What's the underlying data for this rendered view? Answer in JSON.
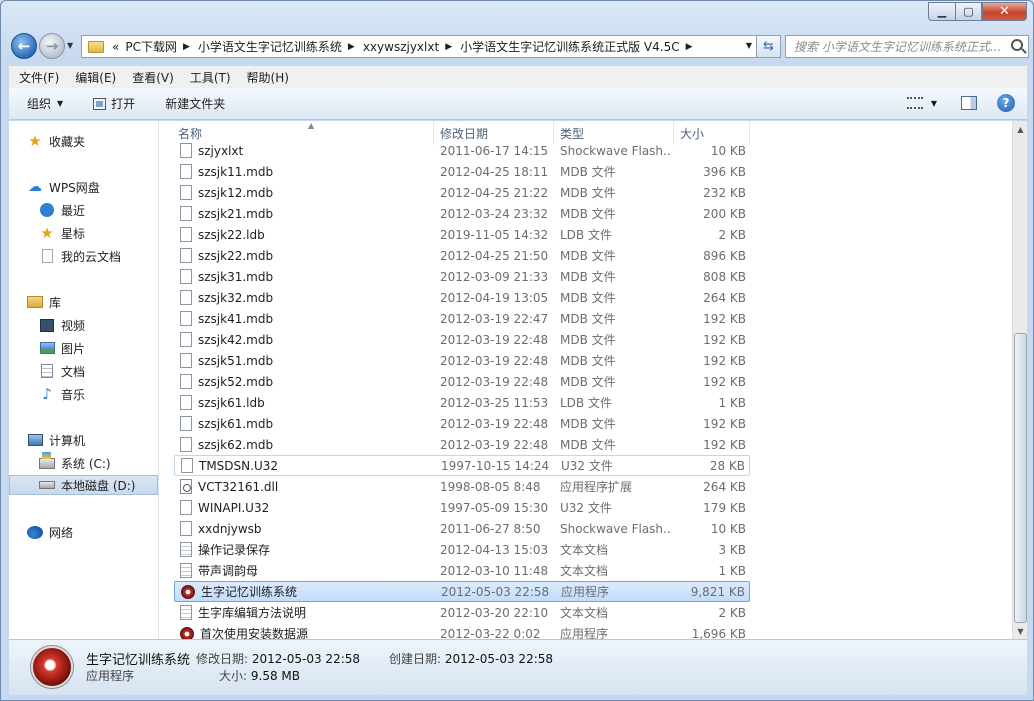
{
  "window": {
    "caption": {
      "minimize": "▁",
      "maximize": "▢",
      "close": "✕"
    }
  },
  "nav": {
    "back_glyph": "←",
    "forward_glyph": "→",
    "overflow": "«",
    "breadcrumbs": [
      "PC下载网",
      "小学语文生字记忆训练系统",
      "xxywszjyxlxt",
      "小学语文生字记忆训练系统正式版 V4.5C"
    ],
    "search_placeholder": "搜索 小学语文生字记忆训练系统正式..."
  },
  "menu": [
    "文件(F)",
    "编辑(E)",
    "查看(V)",
    "工具(T)",
    "帮助(H)"
  ],
  "toolbar": {
    "organize": "组织",
    "open": "打开",
    "new_folder": "新建文件夹",
    "help": "?"
  },
  "nav_pane": {
    "favorites": "收藏夹",
    "wps": "WPS网盘",
    "recent": "最近",
    "starred": "星标",
    "cloud_docs": "我的云文档",
    "libraries": "库",
    "videos": "视频",
    "pictures": "图片",
    "documents": "文档",
    "music": "音乐",
    "computer": "计算机",
    "drive_c": "系统 (C:)",
    "drive_d": "本地磁盘 (D:)",
    "network": "网络"
  },
  "columns": {
    "name": "名称",
    "date": "修改日期",
    "type": "类型",
    "size": "大小"
  },
  "files": [
    {
      "name": "szjyxlxt",
      "date": "2011-06-17 14:15",
      "type": "Shockwave Flash...",
      "size": "10 KB",
      "icon": "flash"
    },
    {
      "name": "szsjk11.mdb",
      "date": "2012-04-25 18:11",
      "type": "MDB 文件",
      "size": "396 KB",
      "icon": "file"
    },
    {
      "name": "szsjk12.mdb",
      "date": "2012-04-25 21:22",
      "type": "MDB 文件",
      "size": "232 KB",
      "icon": "file"
    },
    {
      "name": "szsjk21.mdb",
      "date": "2012-03-24 23:32",
      "type": "MDB 文件",
      "size": "200 KB",
      "icon": "file"
    },
    {
      "name": "szsjk22.ldb",
      "date": "2019-11-05 14:32",
      "type": "LDB 文件",
      "size": "2 KB",
      "icon": "file"
    },
    {
      "name": "szsjk22.mdb",
      "date": "2012-04-25 21:50",
      "type": "MDB 文件",
      "size": "896 KB",
      "icon": "file"
    },
    {
      "name": "szsjk31.mdb",
      "date": "2012-03-09 21:33",
      "type": "MDB 文件",
      "size": "808 KB",
      "icon": "file"
    },
    {
      "name": "szsjk32.mdb",
      "date": "2012-04-19 13:05",
      "type": "MDB 文件",
      "size": "264 KB",
      "icon": "file"
    },
    {
      "name": "szsjk41.mdb",
      "date": "2012-03-19 22:47",
      "type": "MDB 文件",
      "size": "192 KB",
      "icon": "file"
    },
    {
      "name": "szsjk42.mdb",
      "date": "2012-03-19 22:48",
      "type": "MDB 文件",
      "size": "192 KB",
      "icon": "file"
    },
    {
      "name": "szsjk51.mdb",
      "date": "2012-03-19 22:48",
      "type": "MDB 文件",
      "size": "192 KB",
      "icon": "file"
    },
    {
      "name": "szsjk52.mdb",
      "date": "2012-03-19 22:48",
      "type": "MDB 文件",
      "size": "192 KB",
      "icon": "file"
    },
    {
      "name": "szsjk61.ldb",
      "date": "2012-03-25 11:53",
      "type": "LDB 文件",
      "size": "1 KB",
      "icon": "file"
    },
    {
      "name": "szsjk61.mdb",
      "date": "2012-03-19 22:48",
      "type": "MDB 文件",
      "size": "192 KB",
      "icon": "file"
    },
    {
      "name": "szsjk62.mdb",
      "date": "2012-03-19 22:48",
      "type": "MDB 文件",
      "size": "192 KB",
      "icon": "file"
    },
    {
      "name": "TMSDSN.U32",
      "date": "1997-10-15 14:24",
      "type": "U32 文件",
      "size": "28 KB",
      "icon": "file",
      "state": "hl"
    },
    {
      "name": "VCT32161.dll",
      "date": "1998-08-05 8:48",
      "type": "应用程序扩展",
      "size": "264 KB",
      "icon": "dll"
    },
    {
      "name": "WINAPI.U32",
      "date": "1997-05-09 15:30",
      "type": "U32 文件",
      "size": "179 KB",
      "icon": "file"
    },
    {
      "name": "xxdnjywsb",
      "date": "2011-06-27 8:50",
      "type": "Shockwave Flash...",
      "size": "10 KB",
      "icon": "flash"
    },
    {
      "name": "操作记录保存",
      "date": "2012-04-13 15:03",
      "type": "文本文档",
      "size": "3 KB",
      "icon": "txt"
    },
    {
      "name": "带声调韵母",
      "date": "2012-03-10 11:48",
      "type": "文本文档",
      "size": "1 KB",
      "icon": "txt"
    },
    {
      "name": "生字记忆训练系统",
      "date": "2012-05-03 22:58",
      "type": "应用程序",
      "size": "9,821 KB",
      "icon": "app",
      "state": "sel"
    },
    {
      "name": "生字库编辑方法说明",
      "date": "2012-03-20 22:10",
      "type": "文本文档",
      "size": "2 KB",
      "icon": "txt"
    },
    {
      "name": "首次使用安装数据源",
      "date": "2012-03-22 0:02",
      "type": "应用程序",
      "size": "1,696 KB",
      "icon": "app"
    }
  ],
  "details": {
    "name": "生字记忆训练系统",
    "type": "应用程序",
    "modified_label": "修改日期:",
    "modified": "2012-05-03 22:58",
    "size_label": "大小:",
    "size": "9.58 MB",
    "created_label": "创建日期:",
    "created": "2012-05-03 22:58"
  }
}
